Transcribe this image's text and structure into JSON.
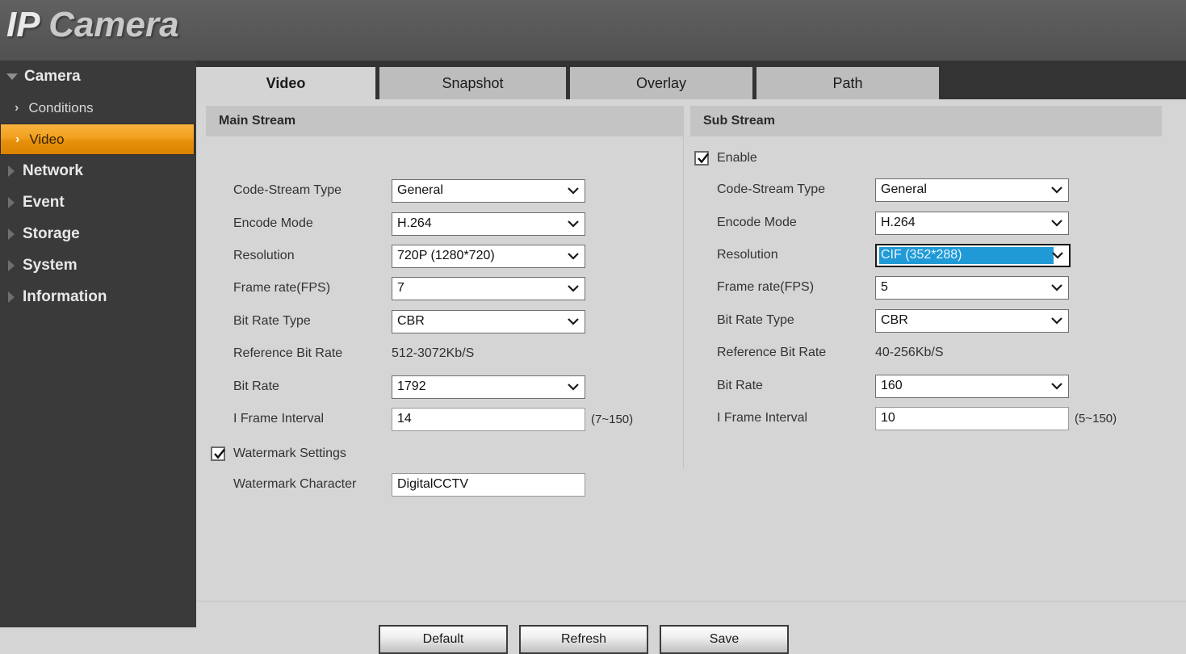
{
  "header": {
    "title_bold": "IP",
    "title_light": "Camera"
  },
  "sidebar": {
    "groups": [
      {
        "label": "Camera",
        "expanded": true,
        "icon": "triangle-down-icon"
      },
      {
        "label": "Network",
        "expanded": false,
        "icon": "triangle-right-icon"
      },
      {
        "label": "Event",
        "expanded": false,
        "icon": "triangle-right-icon"
      },
      {
        "label": "Storage",
        "expanded": false,
        "icon": "triangle-right-icon"
      },
      {
        "label": "System",
        "expanded": false,
        "icon": "triangle-right-icon"
      },
      {
        "label": "Information",
        "expanded": false,
        "icon": "triangle-right-icon"
      }
    ],
    "camera_items": [
      {
        "label": "Conditions",
        "active": false,
        "icon": "chevron-right-icon"
      },
      {
        "label": "Video",
        "active": true,
        "icon": "chevron-right-icon"
      }
    ],
    "chevron": "›",
    "active_color": "#f2a01e"
  },
  "tabs": [
    {
      "label": "Video",
      "active": true
    },
    {
      "label": "Snapshot",
      "active": false
    },
    {
      "label": "Overlay",
      "active": false
    },
    {
      "label": "Path",
      "active": false
    }
  ],
  "main_stream": {
    "section_title": "Main Stream",
    "fields": {
      "code_stream_type": {
        "label": "Code-Stream Type",
        "value": "General",
        "control": "select"
      },
      "encode_mode": {
        "label": "Encode Mode",
        "value": "H.264",
        "control": "select"
      },
      "resolution": {
        "label": "Resolution",
        "value": "720P (1280*720)",
        "control": "select"
      },
      "frame_rate": {
        "label": "Frame rate(FPS)",
        "value": "7",
        "control": "select"
      },
      "bit_rate_type": {
        "label": "Bit Rate Type",
        "value": "CBR",
        "control": "select"
      },
      "reference_bit_rate": {
        "label": "Reference Bit Rate",
        "value": "512-3072Kb/S",
        "control": "static"
      },
      "bit_rate": {
        "label": "Bit Rate",
        "value": "1792",
        "control": "select"
      },
      "i_frame_interval": {
        "label": "I Frame Interval",
        "value": "14",
        "control": "text",
        "hint": "(7~150)"
      },
      "watermark_settings": {
        "label": "Watermark Settings",
        "checked": true
      },
      "watermark_character": {
        "label": "Watermark Character",
        "value": "DigitalCCTV",
        "control": "text"
      }
    }
  },
  "sub_stream": {
    "section_title": "Sub Stream",
    "enable": {
      "label": "Enable",
      "checked": true
    },
    "fields": {
      "code_stream_type": {
        "label": "Code-Stream Type",
        "value": "General",
        "control": "select"
      },
      "encode_mode": {
        "label": "Encode Mode",
        "value": "H.264",
        "control": "select"
      },
      "resolution": {
        "label": "Resolution",
        "value": "CIF (352*288)",
        "control": "select",
        "focused": true,
        "highlight_color": "#1f9ad6"
      },
      "frame_rate": {
        "label": "Frame rate(FPS)",
        "value": "5",
        "control": "select"
      },
      "bit_rate_type": {
        "label": "Bit Rate Type",
        "value": "CBR",
        "control": "select"
      },
      "reference_bit_rate": {
        "label": "Reference Bit Rate",
        "value": "40-256Kb/S",
        "control": "static"
      },
      "bit_rate": {
        "label": "Bit Rate",
        "value": "160",
        "control": "select"
      },
      "i_frame_interval": {
        "label": "I Frame Interval",
        "value": "10",
        "control": "text",
        "hint": "(5~150)"
      }
    }
  },
  "footer": {
    "default_label": "Default",
    "refresh_label": "Refresh",
    "save_label": "Save"
  }
}
